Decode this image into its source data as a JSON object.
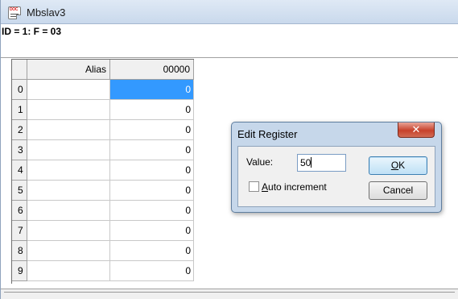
{
  "window": {
    "title": "Mbslav3",
    "icon_text": "DOC"
  },
  "infobar": {
    "text": "ID = 1: F = 03"
  },
  "grid": {
    "columns": [
      "Alias",
      "00000"
    ],
    "rows": [
      {
        "index": "0",
        "alias": "",
        "value": "0",
        "selected": true
      },
      {
        "index": "1",
        "alias": "",
        "value": "0"
      },
      {
        "index": "2",
        "alias": "",
        "value": "0"
      },
      {
        "index": "3",
        "alias": "",
        "value": "0"
      },
      {
        "index": "4",
        "alias": "",
        "value": "0"
      },
      {
        "index": "5",
        "alias": "",
        "value": "0"
      },
      {
        "index": "6",
        "alias": "",
        "value": "0"
      },
      {
        "index": "7",
        "alias": "",
        "value": "0"
      },
      {
        "index": "8",
        "alias": "",
        "value": "0"
      },
      {
        "index": "9",
        "alias": "",
        "value": "0"
      }
    ]
  },
  "dialog": {
    "title": "Edit Register",
    "close_glyph": "✕",
    "value_label": "Value:",
    "value": "50",
    "auto_increment_prefix": "",
    "auto_increment_underlined": "A",
    "auto_increment_rest": "uto increment",
    "auto_increment_checked": false,
    "ok_underlined": "O",
    "ok_rest": "K",
    "cancel_label": "Cancel"
  },
  "colors": {
    "selection": "#3399ff",
    "dialog_frame": "#c6d7ea",
    "close_button": "#c7412b"
  }
}
